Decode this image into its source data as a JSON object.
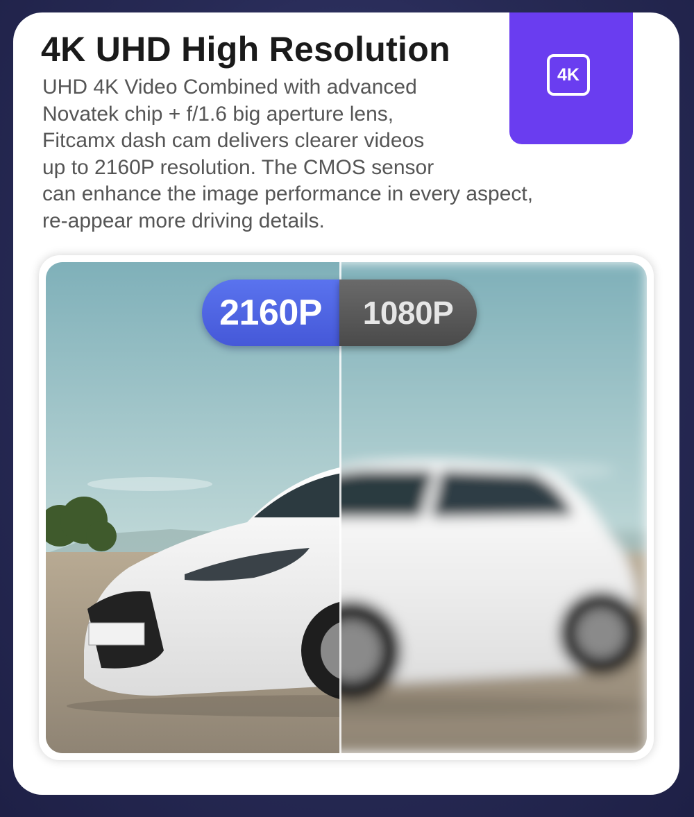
{
  "header": {
    "title": "4K UHD High Resolution",
    "description_lines": [
      "UHD 4K Video Combined with advanced",
      "Novatek chip + f/1.6 big aperture lens,",
      "Fitcamx dash cam delivers clearer videos",
      "up to 2160P resolution. The CMOS sensor",
      "can enhance the image performance in every aspect,",
      "re-appear more driving details."
    ]
  },
  "badge": {
    "label": "4K",
    "color": "#6a3df0"
  },
  "comparison": {
    "left_label": "2160P",
    "right_label": "1080P",
    "left_color": "#4f66e4",
    "right_color": "#555555"
  }
}
